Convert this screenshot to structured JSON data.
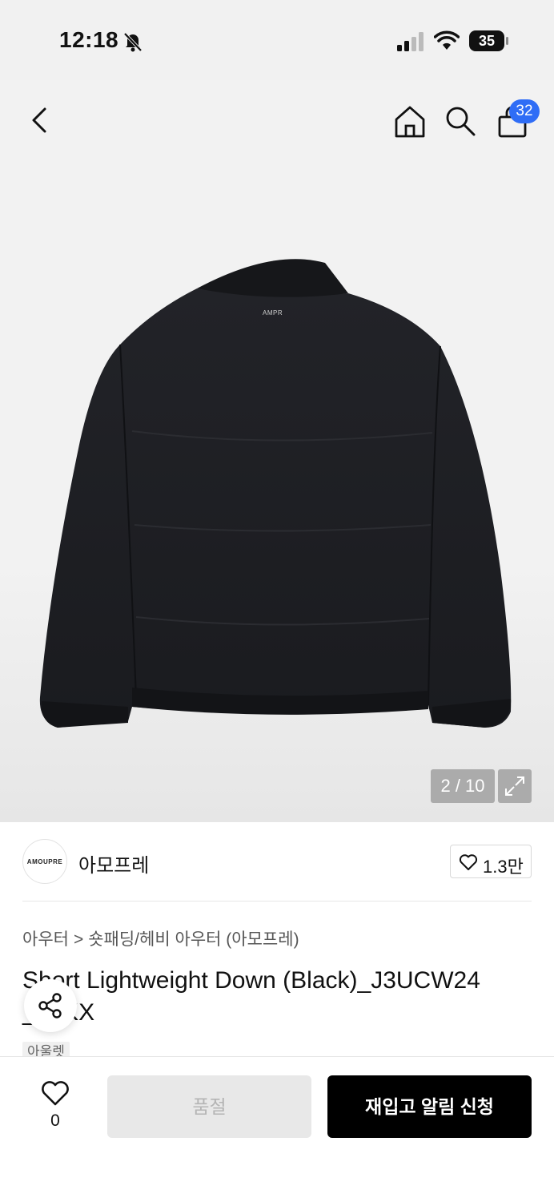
{
  "status_bar": {
    "time": "12:18",
    "battery": "35"
  },
  "header": {
    "cart_count": "32"
  },
  "gallery": {
    "counter": "2 / 10",
    "logo_text": "AMPR"
  },
  "brand": {
    "logo_text": "AMOUPRE",
    "name": "아모프레",
    "likes": "1.3만"
  },
  "breadcrumb": {
    "items": [
      "아우터",
      "숏패딩/헤비 아우터 (아모프레)"
    ]
  },
  "product": {
    "title": "Short Lightweight Down (Black)_J3UCW24 ___KX",
    "tag": "아울렛"
  },
  "bottom_bar": {
    "wish_count": "0",
    "soldout_label": "품절",
    "restock_label": "재입고 알림 신청"
  },
  "colors": {
    "accent": "#2f6df6",
    "jacket": "#1c1d21",
    "primary_button": "#000000"
  }
}
